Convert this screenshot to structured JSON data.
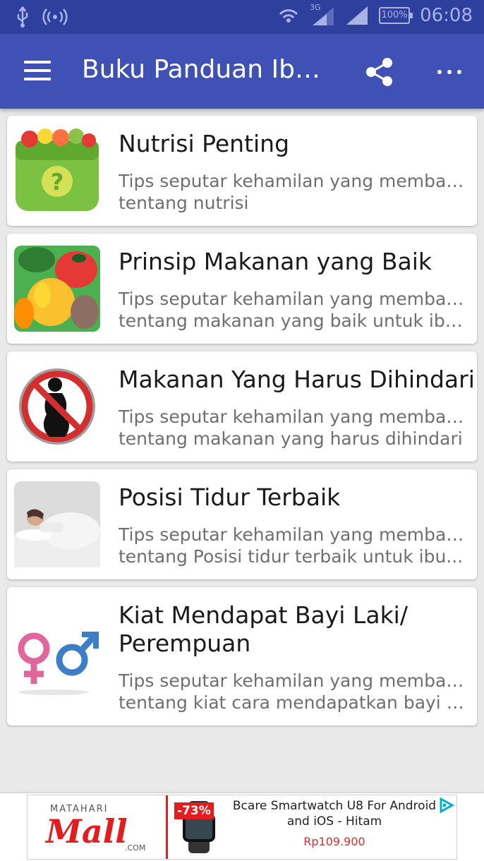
{
  "status_bar": {
    "network": "3G",
    "battery": "100%",
    "time": "06:08"
  },
  "app_bar": {
    "title": "Buku Panduan Ibu..."
  },
  "items": [
    {
      "title": "Nutrisi Penting",
      "desc1": "Tips seputar kehamilan yang membahas",
      "desc2": "tentang nutrisi",
      "icon": "nutrition-basket-icon"
    },
    {
      "title": "Prinsip Makanan yang Baik",
      "desc1": "Tips seputar kehamilan yang membahas",
      "desc2": "tentang makanan yang baik untuk ibu...",
      "icon": "vegetables-icon"
    },
    {
      "title": "Makanan Yang Harus Dihindari",
      "desc1": "Tips seputar kehamilan yang membahas",
      "desc2": "tentang makanan yang harus dihindari",
      "icon": "no-drinking-pregnant-icon"
    },
    {
      "title": "Posisi Tidur Terbaik",
      "desc1": "Tips seputar kehamilan yang membahas",
      "desc2": "tentang Posisi tidur terbaik untuk ibu...",
      "icon": "sleeping-woman-icon"
    },
    {
      "title1": "Kiat Mendapat Bayi Laki/",
      "title2": "Perempuan",
      "desc1": "Tips seputar kehamilan yang membahas",
      "desc2": "tentang kiat cara mendapatkan bayi laki...",
      "icon": "gender-symbols-icon"
    }
  ],
  "ad": {
    "brand_top": "MATAHARI",
    "brand_main": "Mall",
    "brand_suffix": ".COM",
    "discount": "-73%",
    "product_title": "Bcare Smartwatch U8 For Android and iOS - Hitam",
    "price": "Rp109.900",
    "colors": {
      "brand_red": "#e31d1d",
      "adchoice": "#00aecd"
    }
  },
  "colors": {
    "primary": "#3f51b5",
    "primary_dark": "#2f3f9e"
  }
}
